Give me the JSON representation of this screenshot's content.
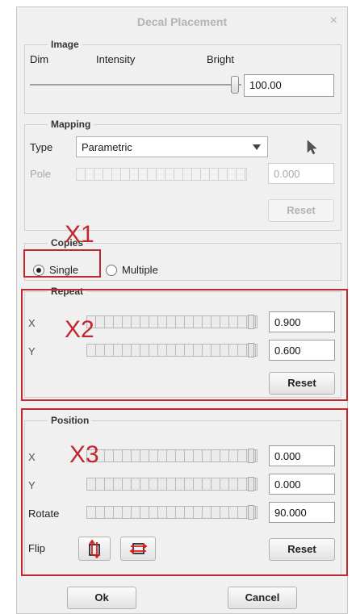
{
  "window": {
    "title": "Decal Placement",
    "close_glyph": "×"
  },
  "image": {
    "group_title": "Image",
    "dim_label": "Dim",
    "intensity_label": "Intensity",
    "bright_label": "Bright",
    "value": "100.00"
  },
  "mapping": {
    "group_title": "Mapping",
    "type_label": "Type",
    "type_value": "Parametric",
    "pole_label": "Pole",
    "pole_value": "0.000",
    "reset_label": "Reset"
  },
  "copies": {
    "group_title": "Copies",
    "single_label": "Single",
    "multiple_label": "Multiple",
    "selected": "Single"
  },
  "repeat": {
    "group_title": "Repeat",
    "x_label": "X",
    "x_value": "0.900",
    "y_label": "Y",
    "y_value": "0.600",
    "reset_label": "Reset"
  },
  "position": {
    "group_title": "Position",
    "x_label": "X",
    "x_value": "0.000",
    "y_label": "Y",
    "y_value": "0.000",
    "rotate_label": "Rotate",
    "rotate_value": "90.000",
    "flip_label": "Flip",
    "reset_label": "Reset"
  },
  "footer": {
    "ok_label": "Ok",
    "cancel_label": "Cancel"
  },
  "annotations": {
    "x1": "X1",
    "x2": "X2",
    "x3": "X3"
  },
  "colors": {
    "annotation": "#c1272d",
    "flip_icon": "#d42020",
    "dialog_bg": "#f0f0f0"
  }
}
